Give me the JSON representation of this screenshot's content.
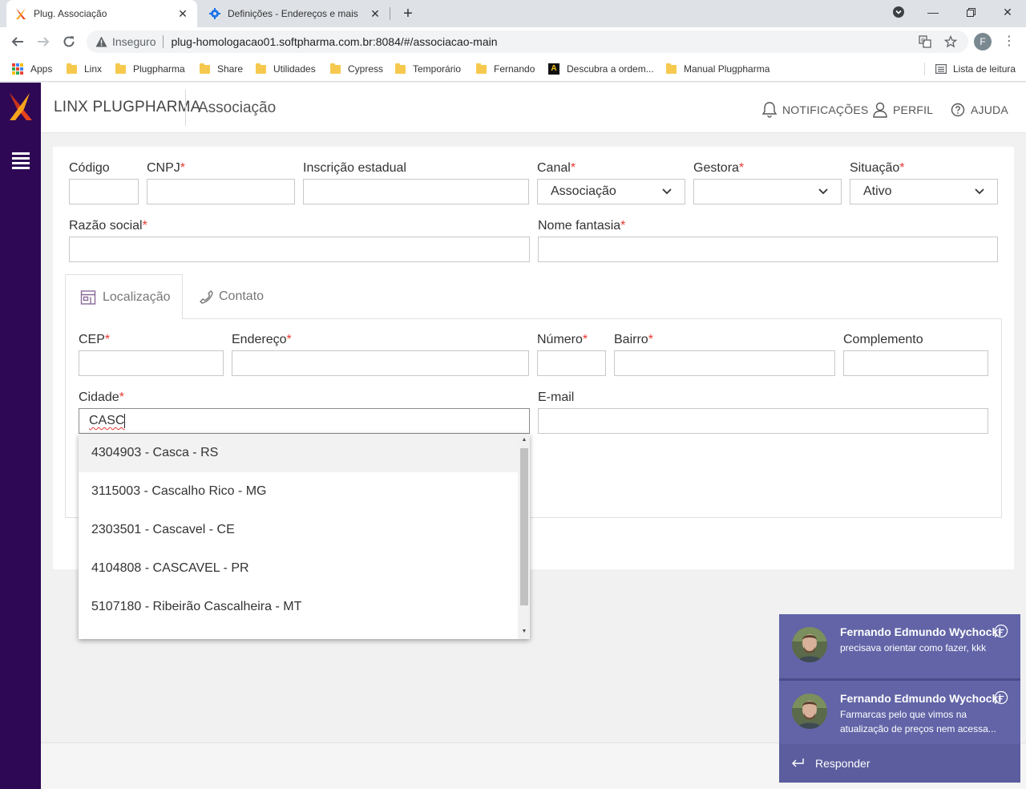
{
  "browser": {
    "tabs": [
      {
        "title": "Plug. Associação",
        "active": true
      },
      {
        "title": "Definições - Endereços e mais",
        "active": false
      }
    ],
    "address": {
      "security_label": "Inseguro",
      "url": "plug-homologacao01.softpharma.com.br:8084/#/associacao-main"
    },
    "profile_initial": "F",
    "bookmarks": [
      {
        "label": "Apps",
        "icon": "apps-grid-icon"
      },
      {
        "label": "Linx",
        "icon": "folder-icon"
      },
      {
        "label": "Plugpharma",
        "icon": "folder-icon"
      },
      {
        "label": "Share",
        "icon": "folder-icon"
      },
      {
        "label": "Utilidades",
        "icon": "folder-icon"
      },
      {
        "label": "Cypress",
        "icon": "folder-icon"
      },
      {
        "label": "Temporário",
        "icon": "folder-icon"
      },
      {
        "label": "Fernando",
        "icon": "folder-icon"
      },
      {
        "label": "Descubra a ordem...",
        "icon": "a-icon"
      },
      {
        "label": "Manual Plugpharma",
        "icon": "folder-icon"
      }
    ],
    "reading_list": "Lista de leitura"
  },
  "header": {
    "brand": "LINX PLUGPHARMA",
    "module": "Associação",
    "notifications": "NOTIFICAÇÕES",
    "profile": "PERFIL",
    "help": "AJUDA"
  },
  "form": {
    "codigo": {
      "label": "Código",
      "value": ""
    },
    "cnpj": {
      "label": "CNPJ",
      "value": "",
      "required": true
    },
    "inscricao": {
      "label": "Inscrição estadual",
      "value": ""
    },
    "canal": {
      "label": "Canal",
      "value": "Associação",
      "required": true
    },
    "gestora": {
      "label": "Gestora",
      "value": "",
      "required": true
    },
    "situacao": {
      "label": "Situação",
      "value": "Ativo",
      "required": true
    },
    "razao": {
      "label": "Razão social",
      "value": "",
      "required": true
    },
    "fantasia": {
      "label": "Nome fantasia",
      "value": "",
      "required": true
    },
    "required_mark": "*"
  },
  "tabs": {
    "localizacao": "Localização",
    "contato": "Contato"
  },
  "location": {
    "cep": {
      "label": "CEP",
      "value": ""
    },
    "endereco": {
      "label": "Endereço",
      "value": ""
    },
    "numero": {
      "label": "Número",
      "value": ""
    },
    "bairro": {
      "label": "Bairro",
      "value": ""
    },
    "complemento": {
      "label": "Complemento",
      "value": ""
    },
    "cidade": {
      "label": "Cidade",
      "value": "CASC"
    },
    "email": {
      "label": "E-mail",
      "value": ""
    }
  },
  "city_suggestions": [
    "4304903 - Casca - RS",
    "3115003 - Cascalho Rico - MG",
    "2303501 - Cascavel - CE",
    "4104808 - CASCAVEL - PR",
    "5107180 - Ribeirão Cascalheira - MT"
  ],
  "notifications": [
    {
      "name": "Fernando Edmundo Wychocki",
      "message": "precisava orientar como fazer, kkk"
    },
    {
      "name": "Fernando Edmundo Wychocki",
      "message": "Farmarcas pelo que vimos na atualização de preços nem acessa..."
    }
  ],
  "reply_label": "Responder",
  "colors": {
    "sidebar": "#2e0854",
    "required": "#e53935",
    "teams_toast": "#6264a7",
    "brand_orange": "#f26722"
  }
}
